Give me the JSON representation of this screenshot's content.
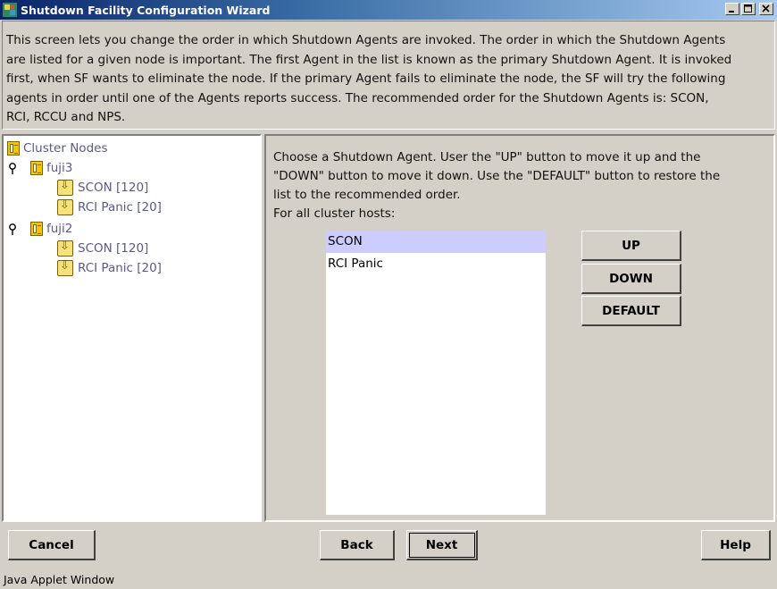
{
  "window": {
    "title": "Shutdown Facility Configuration Wizard",
    "controls": [
      "minimize",
      "maximize",
      "close"
    ]
  },
  "intro": {
    "lines": [
      "This screen lets you change the order in which Shutdown Agents are invoked. The order in which the Shutdown Agents",
      "are listed for a given node is important. The first Agent in the list is known as the primary Shutdown Agent. It is invoked",
      "first, when SF wants to eliminate the node. If the primary Agent fails to eliminate the node, the SF will try the following",
      "agents in order until one of the Agents reports success. The recommended order for the Shutdown Agents is: SCON,",
      "RCI, RCCU and NPS."
    ]
  },
  "tree": {
    "root": "Cluster Nodes",
    "nodes": [
      {
        "name": "fuji3",
        "agents": [
          "SCON [120]",
          "RCI Panic [20]"
        ]
      },
      {
        "name": "fuji2",
        "agents": [
          "SCON [120]",
          "RCI Panic [20]"
        ]
      }
    ]
  },
  "main": {
    "instructions": [
      "Choose a Shutdown Agent. User the \"UP\" button to move it up and the",
      "\"DOWN\" button to move it down. Use the \"DEFAULT\" button to restore the",
      "list to the recommended order."
    ],
    "hosts_label": "For all cluster hosts:",
    "agent_list": [
      {
        "label": "SCON",
        "selected": true
      },
      {
        "label": "RCI Panic",
        "selected": false
      }
    ],
    "up_label": "UP",
    "down_label": "DOWN",
    "default_label": "DEFAULT"
  },
  "footer": {
    "cancel_label": "Cancel",
    "back_label": "Back",
    "next_label": "Next",
    "help_label": "Help"
  },
  "status": "Java Applet Window",
  "colors": {
    "title_gradient_start": "#0a246a",
    "title_gradient_end": "#a6caf0",
    "selection": "#ccccff",
    "tree_text": "#5a5a8c",
    "face": "#d4d0c8"
  }
}
